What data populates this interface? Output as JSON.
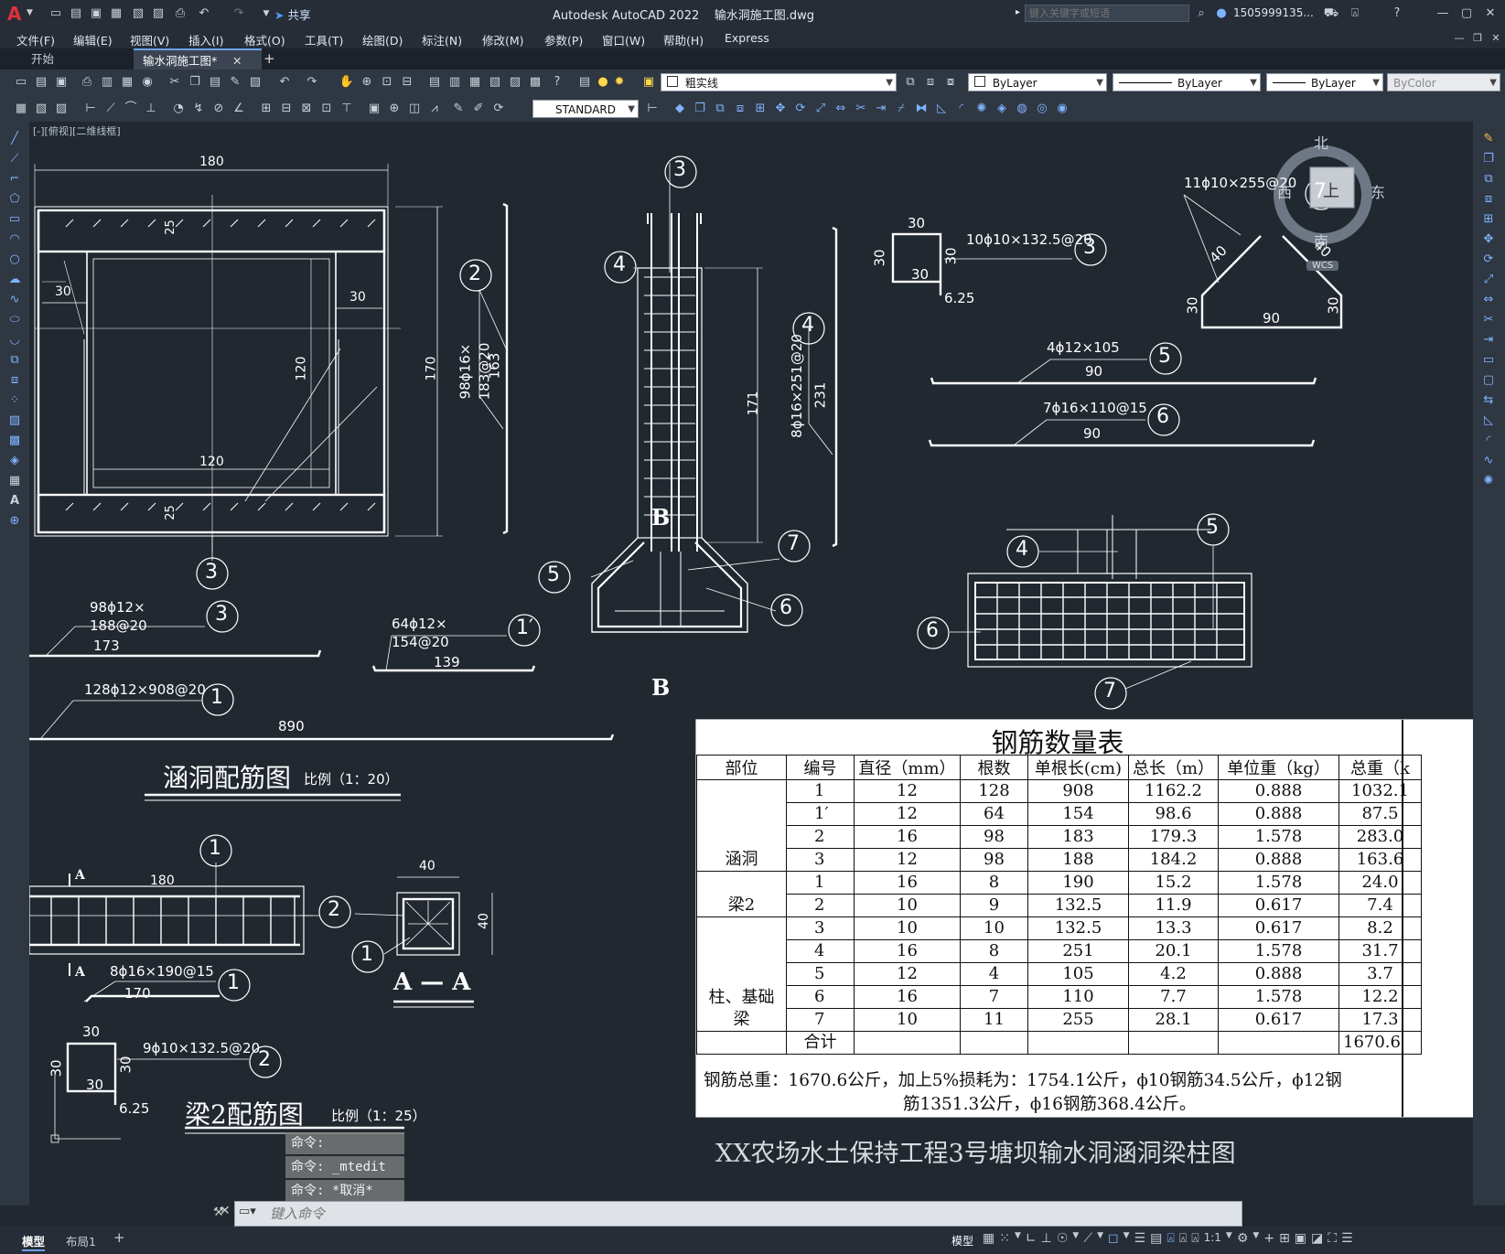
{
  "app": {
    "title": "Autodesk AutoCAD 2022",
    "filename": "输水洞施工图.dwg",
    "share": "共享",
    "search_placeholder": "键入关键字或短语",
    "user": "1505999135...",
    "brand_color": "#c8102e"
  },
  "menu": [
    "文件(F)",
    "编辑(E)",
    "视图(V)",
    "插入(I)",
    "格式(O)",
    "工具(T)",
    "绘图(D)",
    "标注(N)",
    "修改(M)",
    "参数(P)",
    "窗口(W)",
    "帮助(H)",
    "Express"
  ],
  "tabs": {
    "start": "开始",
    "active": "输水洞施工图*"
  },
  "toolbar": {
    "layer": "粗实线",
    "color": "ByLayer",
    "linetype": "ByLayer",
    "lineweight": "ByLayer",
    "plotstyle": "ByColor",
    "textstyle": "STANDARD"
  },
  "viewport_label": "[-][俯视][二维线框]",
  "viewcube": {
    "north": "北",
    "south": "南",
    "east": "东",
    "west": "西",
    "top": "上",
    "wcs": "WCS"
  },
  "drawing": {
    "culvert": {
      "dims": {
        "top": "180",
        "inner_h": "120",
        "inner_w": "120",
        "height": "170",
        "wall_left": "30",
        "wall_right": "30",
        "top_slab": "25",
        "bottom_slab": "25"
      },
      "title": "涵洞配筋图",
      "scale": "比例（1：20）"
    },
    "bar2": {
      "label1": "98ϕ16×",
      "label2": "183@20",
      "len": "163",
      "num": "2"
    },
    "bar3": {
      "label1": "98ϕ12×",
      "label2": "188@20",
      "len": "173",
      "num": "3"
    },
    "bar1prime": {
      "label1": "64ϕ12×",
      "label2": "154@20",
      "len": "139",
      "num": "1′"
    },
    "bar1": {
      "label": "128ϕ12×908@20",
      "len": "890",
      "num": "1"
    },
    "column": {
      "height": "171",
      "num3": "3",
      "num4": "4",
      "num5": "5",
      "num6": "6",
      "num7": "7",
      "section": "B"
    },
    "bar4": {
      "label": "8ϕ16×251@20",
      "len": "231",
      "num": "4"
    },
    "stirrup3": {
      "label": "10ϕ10×132.5@20",
      "w": "30",
      "h": "30",
      "inner": "30",
      "hook": "6.25",
      "num": "3"
    },
    "bar7": {
      "label": "11ϕ10×255@20",
      "a": "40",
      "b": "40",
      "c": "30",
      "d": "30",
      "e": "90",
      "num": "7"
    },
    "bar5": {
      "label": "4ϕ12×105",
      "len": "90",
      "num": "5"
    },
    "bar6": {
      "label": "7ϕ16×110@15",
      "len": "90",
      "num": "6"
    },
    "footing_plan": {
      "num4": "4",
      "num5": "5",
      "num6": "6",
      "num7": "7"
    },
    "beam2": {
      "len": "180",
      "section_mark": "A",
      "section_w": "40",
      "section_h": "40",
      "section_title": "A — A",
      "bar1_label": "8ϕ16×190@15",
      "bar1_len": "170",
      "num1": "1",
      "num2": "2",
      "stirrup_label": "9ϕ10×132.5@20",
      "stirrup_w": "30",
      "stirrup_h": "30",
      "stirrup_inner": "30",
      "stirrup_hook": "6.25",
      "title": "梁2配筋图",
      "scale": "比例（1：25）"
    },
    "title_block": "XX农场水土保持工程3号塘坝输水洞涵洞梁柱图"
  },
  "rebar_table": {
    "title": "钢筋数量表",
    "headers": [
      "部位",
      "编号",
      "直径（mm）",
      "根数",
      "单根长(cm)",
      "总长（m）",
      "单位重（kg）",
      "总重（k"
    ],
    "groups": [
      {
        "name": "涵洞",
        "rows": [
          [
            "1",
            "12",
            "128",
            "908",
            "1162.2",
            "0.888",
            "1032.1"
          ],
          [
            "1′",
            "12",
            "64",
            "154",
            "98.6",
            "0.888",
            "87.5"
          ],
          [
            "2",
            "16",
            "98",
            "183",
            "179.3",
            "1.578",
            "283.0"
          ],
          [
            "3",
            "12",
            "98",
            "188",
            "184.2",
            "0.888",
            "163.6"
          ]
        ]
      },
      {
        "name": "梁2",
        "rows": [
          [
            "1",
            "16",
            "8",
            "190",
            "15.2",
            "1.578",
            "24.0"
          ],
          [
            "2",
            "10",
            "9",
            "132.5",
            "11.9",
            "0.617",
            "7.4"
          ]
        ]
      },
      {
        "name": "柱、基础梁",
        "rows": [
          [
            "3",
            "10",
            "10",
            "132.5",
            "13.3",
            "0.617",
            "8.2"
          ],
          [
            "4",
            "16",
            "8",
            "251",
            "20.1",
            "1.578",
            "31.7"
          ],
          [
            "5",
            "12",
            "4",
            "105",
            "4.2",
            "0.888",
            "3.7"
          ],
          [
            "6",
            "16",
            "7",
            "110",
            "7.7",
            "1.578",
            "12.2"
          ],
          [
            "7",
            "10",
            "11",
            "255",
            "28.1",
            "0.617",
            "17.3"
          ]
        ]
      }
    ],
    "total_label": "合计",
    "total_value": "1670.6",
    "note_line1": "钢筋总重：1670.6公斤，加上5%损耗为：1754.1公斤，ϕ10钢筋34.5公斤，ϕ12钢",
    "note_line2": "筋1351.3公斤，ϕ16钢筋368.4公斤。"
  },
  "command": {
    "history": [
      "命令:",
      "命令: _mtedit",
      "命令: *取消*"
    ],
    "placeholder": "键入命令"
  },
  "layout_tabs": [
    "模型",
    "布局1"
  ],
  "status": {
    "model": "模型",
    "scale": "1:1"
  }
}
